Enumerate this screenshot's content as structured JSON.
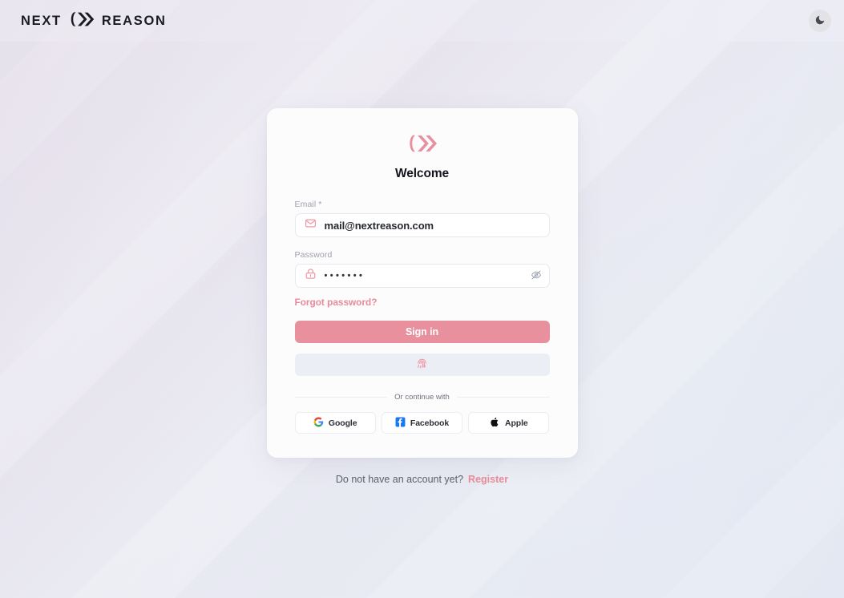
{
  "header": {
    "brand_left": "NEXT",
    "brand_right": "REASON",
    "brand_logo_icon": "chevrons-logo-icon",
    "theme_toggle_icon": "moon-icon"
  },
  "card": {
    "logo_icon": "chevrons-logo-icon",
    "title": "Welcome",
    "email": {
      "label": "Email *",
      "value": "mail@nextreason.com",
      "placeholder": "Email",
      "icon": "mail-icon"
    },
    "password": {
      "label": "Password",
      "value": "•••••••",
      "placeholder": "Password",
      "icon": "lock-icon",
      "toggle_icon": "eye-off-icon"
    },
    "forgot_password": "Forgot password?",
    "signin_label": "Sign in",
    "biometric_icon": "fingerprint-icon",
    "divider_text": "Or continue with",
    "social": [
      {
        "label": "Google",
        "icon": "google-icon"
      },
      {
        "label": "Facebook",
        "icon": "facebook-icon"
      },
      {
        "label": "Apple",
        "icon": "apple-icon"
      }
    ]
  },
  "footer": {
    "prompt": "Do not have an account yet?",
    "register_label": "Register"
  },
  "colors": {
    "accent": "#e8909d",
    "accent_link": "#e98a98",
    "brand_text": "#1a1c23",
    "card_bg": "#fcfcfd",
    "biometric_bg": "#eceef6",
    "google_blue": "#4285f4",
    "google_red": "#ea4335",
    "google_yellow": "#fbbc05",
    "google_green": "#34a853",
    "facebook_blue": "#1877f2",
    "apple_black": "#111111"
  }
}
